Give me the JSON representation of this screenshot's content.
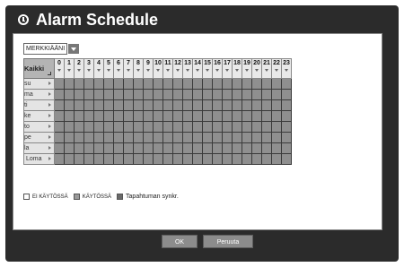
{
  "window": {
    "title": "Alarm Schedule",
    "icon": "clock-icon"
  },
  "mode": {
    "selected": "MERKKIÄÄNI"
  },
  "grid": {
    "corner_label": "Kaikki",
    "hours": [
      "0",
      "1",
      "2",
      "3",
      "4",
      "5",
      "6",
      "7",
      "8",
      "9",
      "10",
      "11",
      "12",
      "13",
      "14",
      "15",
      "16",
      "17",
      "18",
      "19",
      "20",
      "21",
      "22",
      "23"
    ],
    "days": [
      "su",
      "ma",
      "ti",
      "ke",
      "to",
      "pe",
      "la",
      "Loma"
    ]
  },
  "legend": {
    "off_label": "EI KÄYTÖSSÄ",
    "on_label": "KÄYTÖSSÄ",
    "sync_label": "Tapahtuman synkr.",
    "off_color": "#ffffff",
    "on_color": "#9a9a9a",
    "sync_color": "#6a6a6a"
  },
  "buttons": {
    "ok": "OK",
    "cancel": "Peruuta"
  }
}
